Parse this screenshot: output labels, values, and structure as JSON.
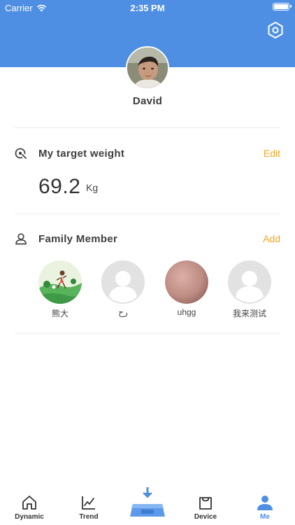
{
  "status_bar": {
    "carrier": "Carrier",
    "time": "2:35 PM"
  },
  "profile": {
    "name": "David"
  },
  "target_weight": {
    "title": "My target weight",
    "action": "Edit",
    "value": "69.2",
    "unit": "Kg"
  },
  "family": {
    "title": "Family Member",
    "action": "Add",
    "members": [
      {
        "name": "熊大"
      },
      {
        "name": "رح"
      },
      {
        "name": "uhgg"
      },
      {
        "name": "我来测试"
      }
    ]
  },
  "tabbar": {
    "items": [
      {
        "label": "Dynamic",
        "icon": "house-icon"
      },
      {
        "label": "Trend",
        "icon": "chart-icon"
      },
      {
        "label": "",
        "icon": "scale-sync-icon"
      },
      {
        "label": "Device",
        "icon": "bag-icon"
      },
      {
        "label": "Me",
        "icon": "person-icon"
      }
    ],
    "active": "Me"
  },
  "colors": {
    "primary": "#4f8fe3",
    "accent": "#f5a623",
    "divider": "#ececec"
  }
}
